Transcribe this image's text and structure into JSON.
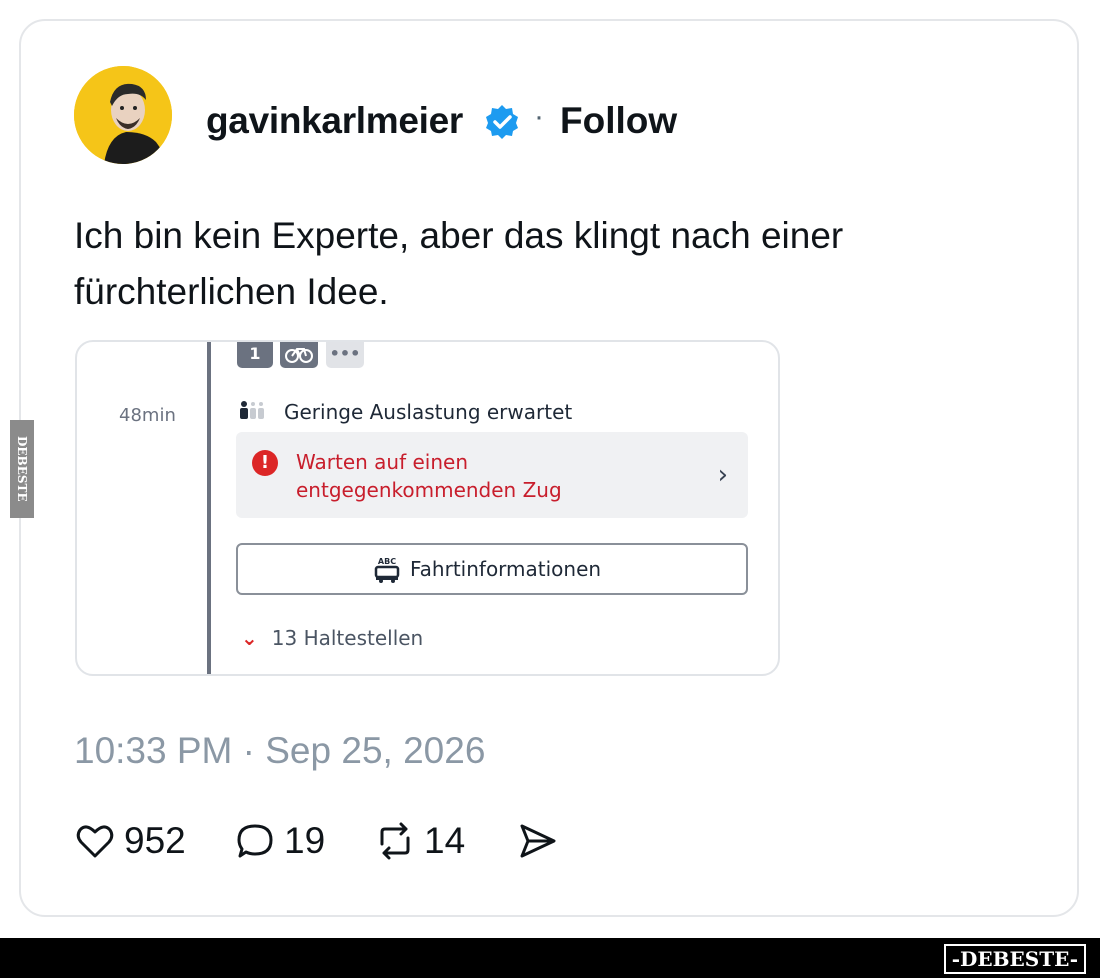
{
  "tweet": {
    "username": "gavinkarlmeier",
    "separator": "·",
    "follow_label": "Follow",
    "text_lines": [
      "Ich bin kein Experte, aber das klingt nach einer",
      "fürchterlichen Idee."
    ],
    "timestamp": "10:33 PM · Sep 25, 2026",
    "likes": "952",
    "replies": "19",
    "reposts": "14"
  },
  "embed": {
    "badges": [
      "1",
      "",
      "•••"
    ],
    "duration": "48min",
    "occupancy": "Geringe Auslastung erwartet",
    "warning_lines": [
      "Warten auf einen",
      "entgegenkommenden Zug"
    ],
    "info_button_icon_text": "ABC",
    "info_button": "Fahrtinformationen",
    "stops": "13 Haltestellen",
    "colors": {
      "warning": "#c81e2c",
      "timeline": "#6b7280"
    }
  },
  "watermark": {
    "side": "DEBESTE",
    "footer": "-DEBESTE-"
  },
  "colors": {
    "verified": "#1d9bf0",
    "avatar_bg": "#f5c518",
    "muted": "#8b98a5"
  }
}
